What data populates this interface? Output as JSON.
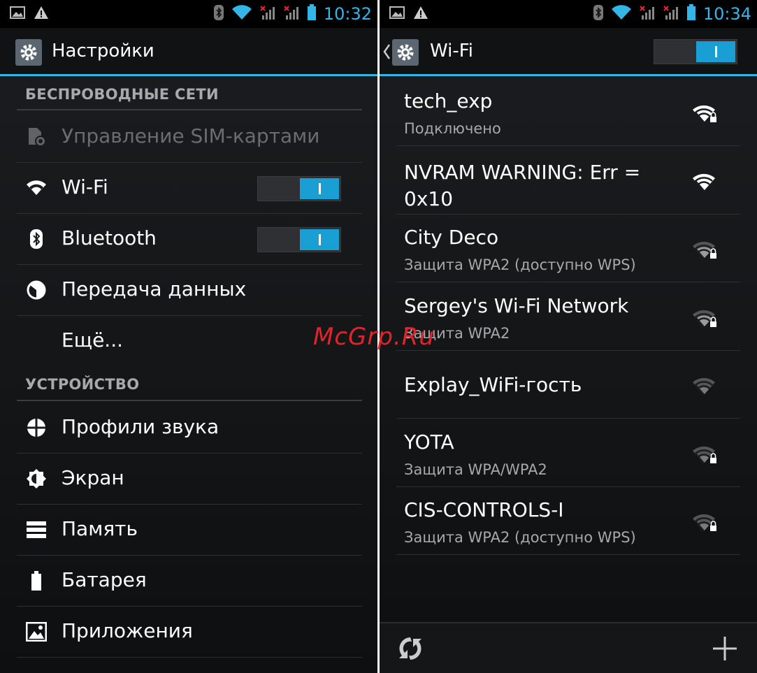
{
  "left": {
    "status": {
      "time": "10:32"
    },
    "actionbar": {
      "title": "Настройки"
    },
    "sections": {
      "wireless": "БЕСПРОВОДНЫЕ СЕТИ",
      "device": "УСТРОЙСТВО"
    },
    "items": {
      "sim": "Управление SIM-картами",
      "wifi": "Wi-Fi",
      "bluetooth": "Bluetooth",
      "data": "Передача данных",
      "more": "Ещё...",
      "sound": "Профили звука",
      "display": "Экран",
      "storage": "Память",
      "battery": "Батарея",
      "apps": "Приложения"
    },
    "switches": {
      "wifi_on": true,
      "bluetooth_on": true
    }
  },
  "right": {
    "status": {
      "time": "10:34"
    },
    "actionbar": {
      "title": "Wi-Fi",
      "wifi_switch_on": true
    },
    "networks": [
      {
        "name": "tech_exp",
        "status": "Подключено",
        "secured": true,
        "strength": "full"
      },
      {
        "name": "NVRAM WARNING: Err = 0x10",
        "status": "",
        "secured": false,
        "strength": "full"
      },
      {
        "name": "City Deco",
        "status": "Защита WPA2 (доступно WPS)",
        "secured": true,
        "strength": "medium"
      },
      {
        "name": "Sergey's Wi-Fi Network",
        "status": "Защита WPA2",
        "secured": true,
        "strength": "medium"
      },
      {
        "name": "Explay_WiFi-гость",
        "status": "",
        "secured": false,
        "strength": "weak"
      },
      {
        "name": "YOTA",
        "status": "Защита WPA/WPA2",
        "secured": true,
        "strength": "weak"
      },
      {
        "name": "CIS-CONTROLS-I",
        "status": "Защита WPA2 (доступно WPS)",
        "secured": true,
        "strength": "weak"
      }
    ]
  },
  "watermark": "McGrp.Ru",
  "colors": {
    "accent": "#33b5e5",
    "switch_on": "#1a9fd4",
    "watermark": "#e0242b"
  }
}
